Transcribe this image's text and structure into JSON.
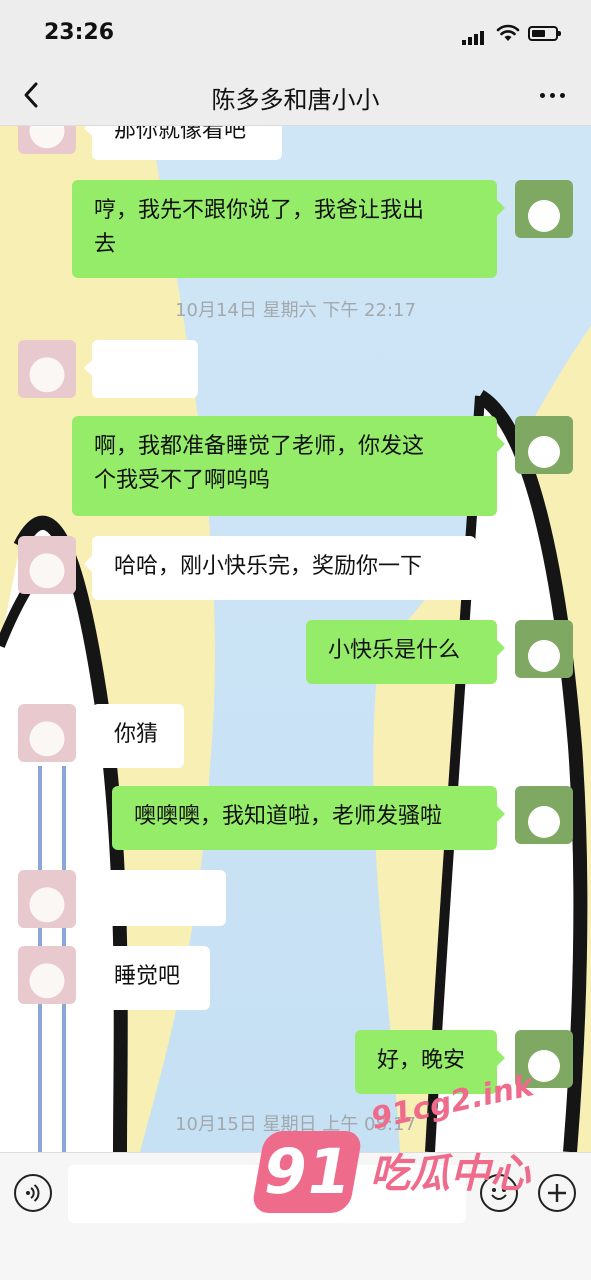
{
  "status_bar": {
    "time": "23:26"
  },
  "header": {
    "title": "陈多多和唐小小"
  },
  "messages": [
    {
      "side": "left",
      "text": "那你就像看吧"
    },
    {
      "side": "right",
      "text_line1": "哼，我先不跟你说了，我爸让我出",
      "text_line2": "去"
    },
    {
      "type": "time",
      "text": "10月14日 星期六 下午 22:17"
    },
    {
      "side": "left",
      "text": ""
    },
    {
      "side": "right",
      "text_line1": "啊，我都准备睡觉了老师，你发这",
      "text_line2": "个我受不了啊呜呜"
    },
    {
      "side": "left",
      "text": "哈哈，刚小快乐完，奖励你一下"
    },
    {
      "side": "right",
      "text": "小快乐是什么"
    },
    {
      "side": "left",
      "text": "你猜"
    },
    {
      "side": "right",
      "text": "噢噢噢，我知道啦，老师发骚啦"
    },
    {
      "side": "left",
      "text": ""
    },
    {
      "side": "left",
      "text": "睡觉吧"
    },
    {
      "side": "right",
      "text": "好，晚安"
    },
    {
      "type": "time",
      "text": "10月15日 星期日 上午 08:17"
    }
  ],
  "input_bar": {
    "text": ""
  },
  "watermark": {
    "url": "91cg2.ink",
    "number": "91",
    "brand": "吃瓜中心"
  },
  "colors": {
    "bubble_right": "#95ec69",
    "bubble_left": "#ffffff",
    "chat_background": "#c6e0f4",
    "watermark": "#ef6b8c"
  }
}
